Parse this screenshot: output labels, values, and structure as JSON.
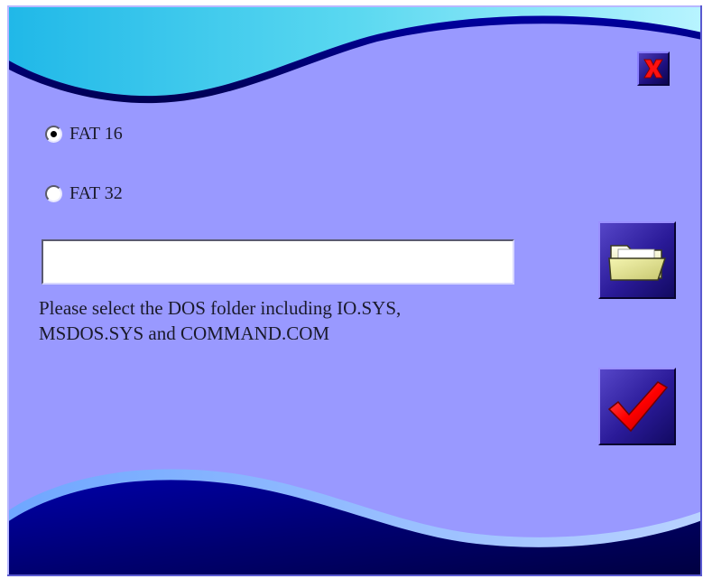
{
  "dialog": {
    "options": [
      {
        "label": "FAT 16",
        "selected": true
      },
      {
        "label": "FAT 32",
        "selected": false
      }
    ],
    "folder_path": {
      "value": "",
      "placeholder": ""
    },
    "help_line_1": "Please select the DOS folder including IO.SYS,",
    "help_line_2": "MSDOS.SYS and COMMAND.COM"
  },
  "buttons": {
    "close": {
      "icon": "close-x-icon"
    },
    "browse": {
      "icon": "folder-icon"
    },
    "confirm": {
      "icon": "checkmark-icon"
    }
  },
  "colors": {
    "background": "#9999ff",
    "wave_dark": "#000066",
    "wave_light": "#3fc8e8",
    "close_red": "#ff0000",
    "check_red": "#ff0000",
    "folder_yellow": "#eeee99"
  }
}
